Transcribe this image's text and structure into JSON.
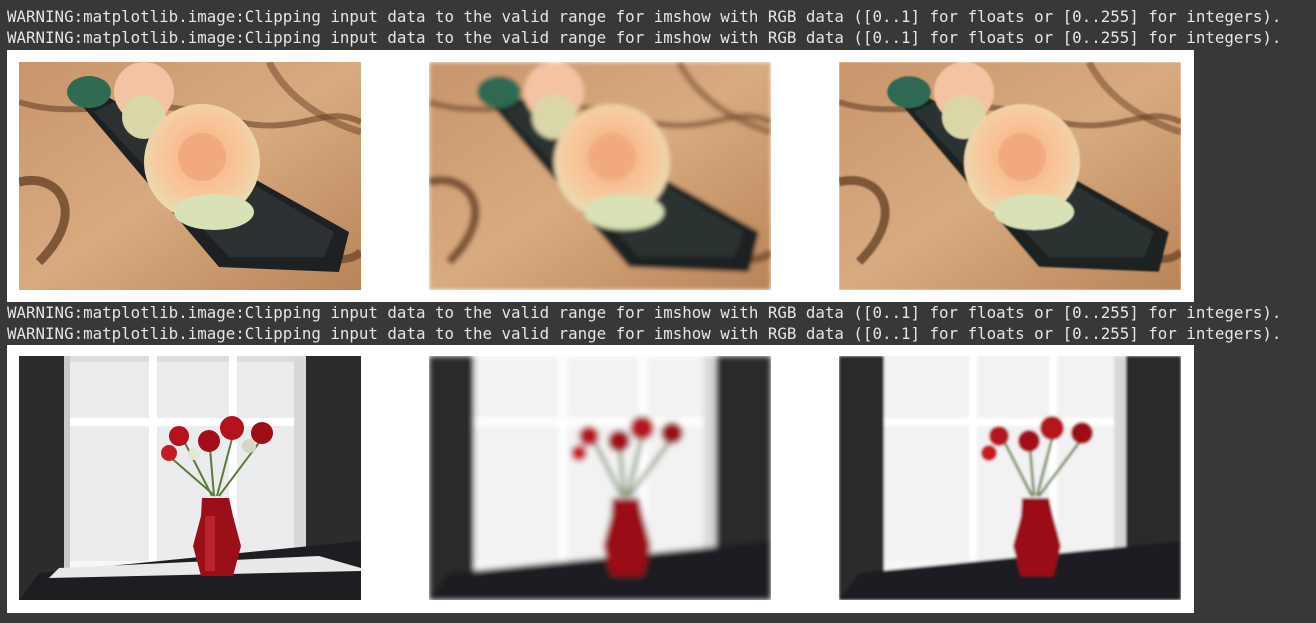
{
  "cell_output": {
    "warnings_block_1": [
      "WARNING:matplotlib.image:Clipping input data to the valid range for imshow with RGB data ([0..1] for floats or [0..255] for integers).",
      "WARNING:matplotlib.image:Clipping input data to the valid range for imshow with RGB data ([0..1] for floats or [0..255] for integers)."
    ],
    "warnings_block_2": [
      "WARNING:matplotlib.image:Clipping input data to the valid range for imshow with RGB data ([0..1] for floats or [0..255] for integers).",
      "WARNING:matplotlib.image:Clipping input data to the valid range for imshow with RGB data ([0..1] for floats or [0..255] for integers)."
    ]
  },
  "figures": [
    {
      "subject": "roses in black dish on wood table",
      "panels": [
        "original",
        "blurred",
        "restored"
      ]
    },
    {
      "subject": "red roses in vase on window sill",
      "panels": [
        "original",
        "blurred",
        "restored"
      ]
    }
  ],
  "colors": {
    "output_background": "#383838",
    "text": "#e6e6e6",
    "figure_background": "#ffffff"
  }
}
